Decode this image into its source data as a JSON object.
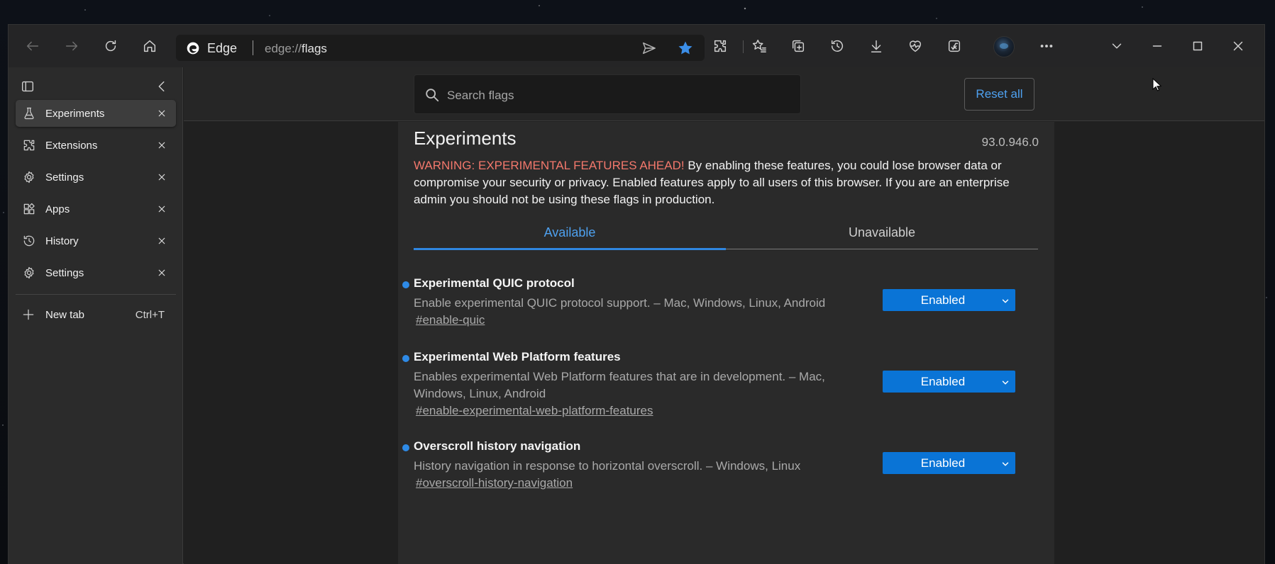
{
  "colors": {
    "accent": "#0a74d6",
    "link": "#4ea1f0",
    "warning": "#f3786c",
    "modified_dot": "#2e8ae6",
    "favorite_star": "#3b8ee8"
  },
  "toolbar": {
    "brand": "Edge",
    "url_scheme": "edge://",
    "url_host": "flags",
    "icons": [
      "back-icon",
      "forward-icon",
      "refresh-icon",
      "home-icon",
      "share-icon",
      "favorite-star-icon",
      "extensions-icon",
      "favorites-icon",
      "collections-icon",
      "history-icon",
      "downloads-icon",
      "browser-essentials-icon",
      "math-solver-icon",
      "profile-avatar",
      "more-icon",
      "tab-actions-chevron",
      "minimize-icon",
      "maximize-icon",
      "close-icon"
    ]
  },
  "sidebar": {
    "tabs": [
      {
        "label": "Experiments",
        "icon": "beaker-icon",
        "active": true
      },
      {
        "label": "Extensions",
        "icon": "puzzle-icon",
        "active": false
      },
      {
        "label": "Settings",
        "icon": "gear-icon",
        "active": false
      },
      {
        "label": "Apps",
        "icon": "apps-icon",
        "active": false
      },
      {
        "label": "History",
        "icon": "history-icon",
        "active": false
      },
      {
        "label": "Settings",
        "icon": "gear-icon",
        "active": false
      }
    ],
    "new_tab": {
      "label": "New tab",
      "shortcut": "Ctrl+T"
    }
  },
  "flags_page": {
    "search_placeholder": "Search flags",
    "reset_label": "Reset all",
    "title": "Experiments",
    "version": "93.0.946.0",
    "warning_prefix": "WARNING: EXPERIMENTAL FEATURES AHEAD!",
    "warning_body": " By enabling these features, you could lose browser data or compromise your security or privacy. Enabled features apply to all users of this browser. If you are an enterprise admin you should not be using these flags in production.",
    "tabs": [
      {
        "label": "Available",
        "selected": true
      },
      {
        "label": "Unavailable",
        "selected": false
      }
    ],
    "flags": [
      {
        "name": "Experimental QUIC protocol",
        "description": "Enable experimental QUIC protocol support. – Mac, Windows, Linux, Android",
        "anchor": "#enable-quic",
        "value": "Enabled"
      },
      {
        "name": "Experimental Web Platform features",
        "description": "Enables experimental Web Platform features that are in development. – Mac, Windows, Linux, Android",
        "anchor": "#enable-experimental-web-platform-features",
        "value": "Enabled"
      },
      {
        "name": "Overscroll history navigation",
        "description": "History navigation in response to horizontal overscroll. – Windows, Linux",
        "anchor": "#overscroll-history-navigation",
        "value": "Enabled"
      }
    ]
  }
}
